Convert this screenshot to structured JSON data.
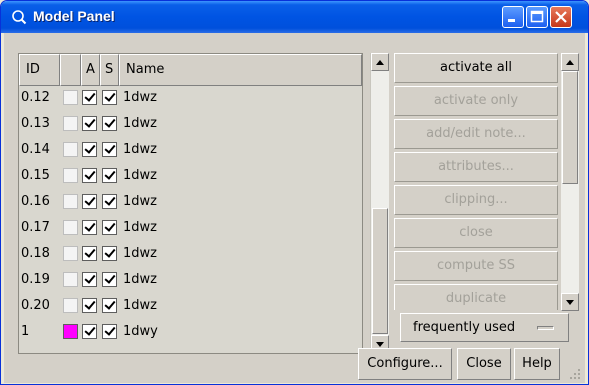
{
  "window": {
    "title": "Model Panel"
  },
  "table": {
    "columns": [
      "ID",
      "",
      "A",
      "S",
      "Name"
    ],
    "rows": [
      {
        "id": "0.12",
        "shown": false,
        "a": true,
        "s": true,
        "name": "1dwz"
      },
      {
        "id": "0.13",
        "shown": false,
        "a": true,
        "s": true,
        "name": "1dwz"
      },
      {
        "id": "0.14",
        "shown": false,
        "a": true,
        "s": true,
        "name": "1dwz"
      },
      {
        "id": "0.15",
        "shown": false,
        "a": true,
        "s": true,
        "name": "1dwz"
      },
      {
        "id": "0.16",
        "shown": false,
        "a": true,
        "s": true,
        "name": "1dwz"
      },
      {
        "id": "0.17",
        "shown": false,
        "a": true,
        "s": true,
        "name": "1dwz"
      },
      {
        "id": "0.18",
        "shown": false,
        "a": true,
        "s": true,
        "name": "1dwz"
      },
      {
        "id": "0.19",
        "shown": false,
        "a": true,
        "s": true,
        "name": "1dwz"
      },
      {
        "id": "0.20",
        "shown": false,
        "a": true,
        "s": true,
        "name": "1dwz"
      },
      {
        "id": "1",
        "shown": true,
        "color": "#ff00ff",
        "a": true,
        "s": true,
        "name": "1dwy"
      }
    ]
  },
  "actions": [
    {
      "label": "activate all",
      "enabled": true
    },
    {
      "label": "activate only",
      "enabled": false
    },
    {
      "label": "add/edit note...",
      "enabled": false
    },
    {
      "label": "attributes...",
      "enabled": false
    },
    {
      "label": "clipping...",
      "enabled": false
    },
    {
      "label": "close",
      "enabled": false
    },
    {
      "label": "compute SS",
      "enabled": false
    },
    {
      "label": "duplicate",
      "enabled": false
    }
  ],
  "dropdown": {
    "selected": "frequently used"
  },
  "footer": {
    "configure": "Configure...",
    "close": "Close",
    "help": "Help"
  }
}
